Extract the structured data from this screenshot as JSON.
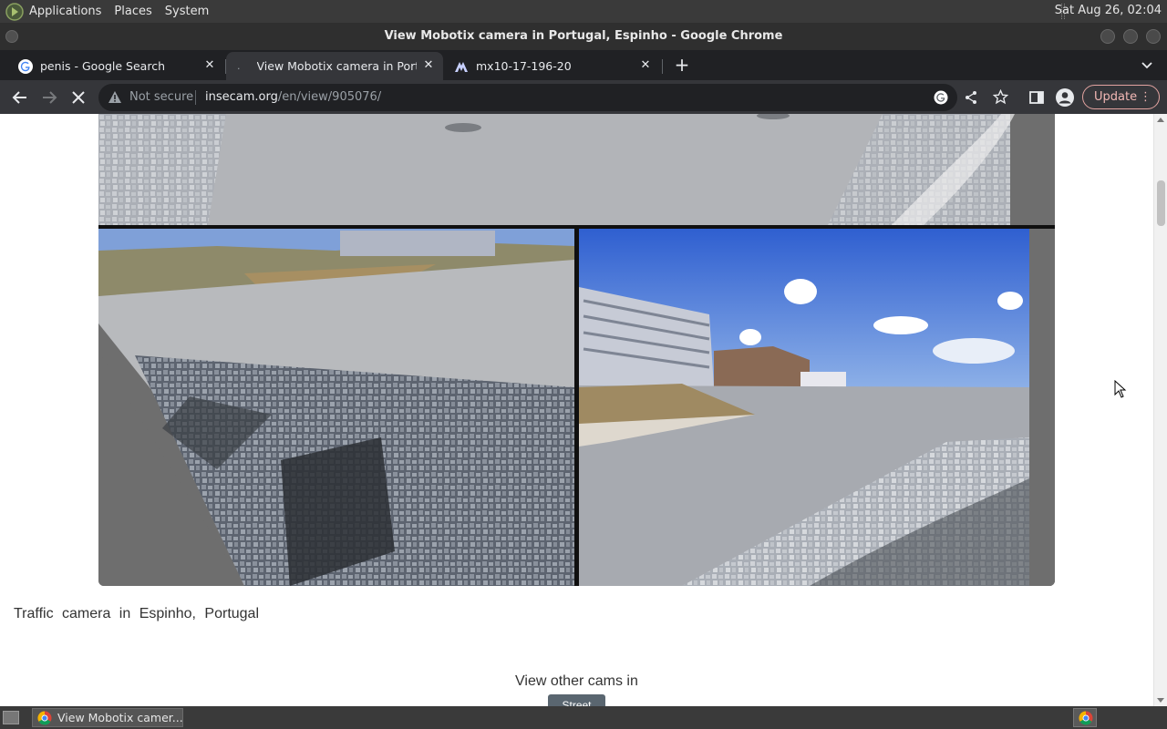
{
  "top_panel": {
    "menus": [
      "Applications",
      "Places",
      "System"
    ],
    "clock": "Sat Aug 26, 02:04"
  },
  "window": {
    "title": "View Mobotix camera in Portugal, Espinho - Google Chrome"
  },
  "tabs": [
    {
      "title": "penis - Google Search",
      "icon": "google-icon",
      "active": false
    },
    {
      "title": "View Mobotix camera in Portugal",
      "icon": "loading-icon",
      "active": true
    },
    {
      "title": "mx10-17-196-20",
      "icon": "mobotix-icon",
      "active": false
    }
  ],
  "toolbar": {
    "security_label": "Not secure",
    "url_host": "insecam.org",
    "url_path": "/en/view/905076/",
    "update_label": "Update"
  },
  "page": {
    "caption": "Traffic camera in Espinho, Portugal",
    "view_other": "View other cams in",
    "street_button": "Street"
  },
  "taskbar": {
    "item_label": "View Mobotix camer..."
  },
  "colors": {
    "chrome_dark": "#202124",
    "toolbar": "#35363a",
    "update_outline": "#e2a3a0",
    "page_bg": "#ffffff"
  }
}
